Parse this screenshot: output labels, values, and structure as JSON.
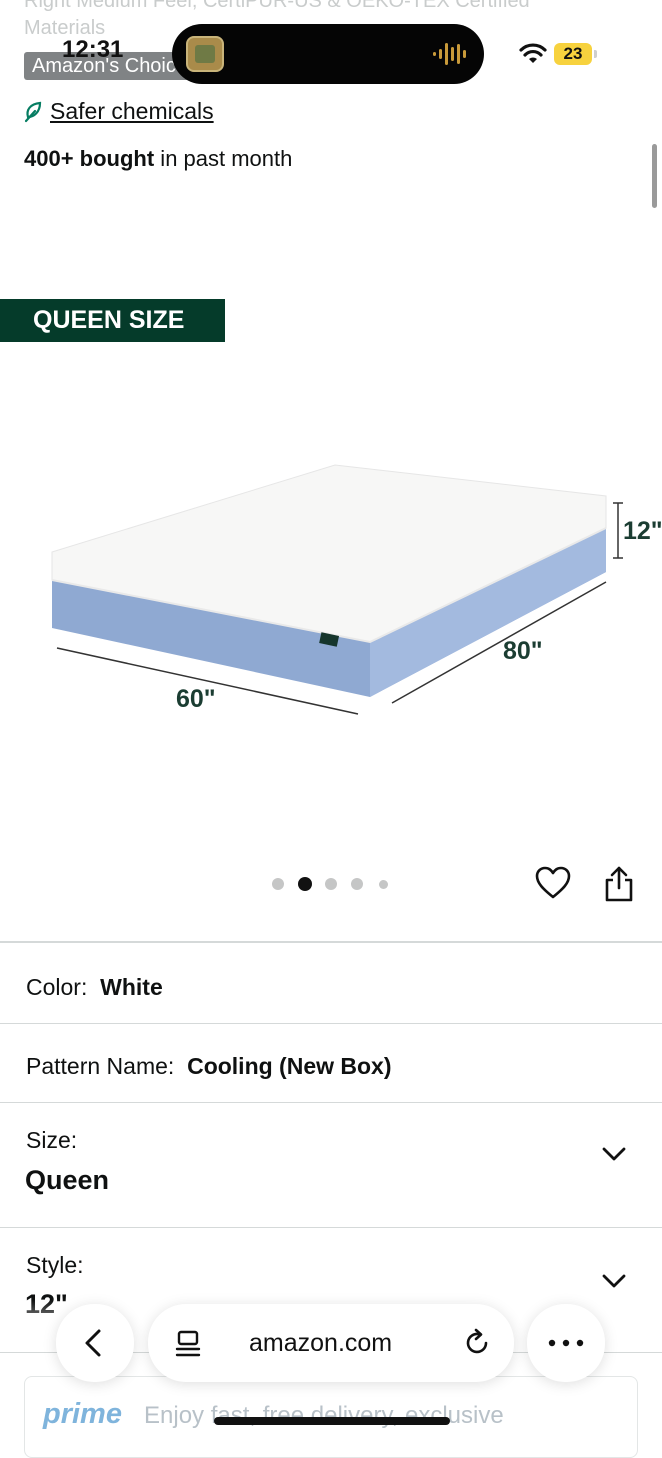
{
  "background": {
    "line1": "Right Medium Feel, CertiPUR-US & OEKO-TEX Certified",
    "line2": "Materials",
    "badge": "Amazon's Choice"
  },
  "status_bar": {
    "time": "12:31",
    "battery": "23"
  },
  "product": {
    "safer_label": "Safer chemicals",
    "bought_count": "400+ bought",
    "bought_suffix": " in past month",
    "image": {
      "tag": "QUEEN SIZE",
      "height_dim": "12\"",
      "length_dim": "80\"",
      "width_dim": "60\""
    },
    "carousel": {
      "total": 5,
      "active_index": 1
    }
  },
  "variations": {
    "color": {
      "label": "Color:",
      "value": "White"
    },
    "pattern": {
      "label": "Pattern Name:",
      "value": "Cooling (New Box)"
    },
    "size": {
      "label": "Size:",
      "value": "Queen"
    },
    "style": {
      "label": "Style:",
      "value": "12\""
    }
  },
  "browser": {
    "url": "amazon.com"
  },
  "prime_banner": {
    "logo": "prime",
    "text": "Enjoy fast, free delivery, exclusive"
  },
  "colors": {
    "accent_dark_green": "#053b2a",
    "mattress_blue": "#8aa6cf"
  }
}
